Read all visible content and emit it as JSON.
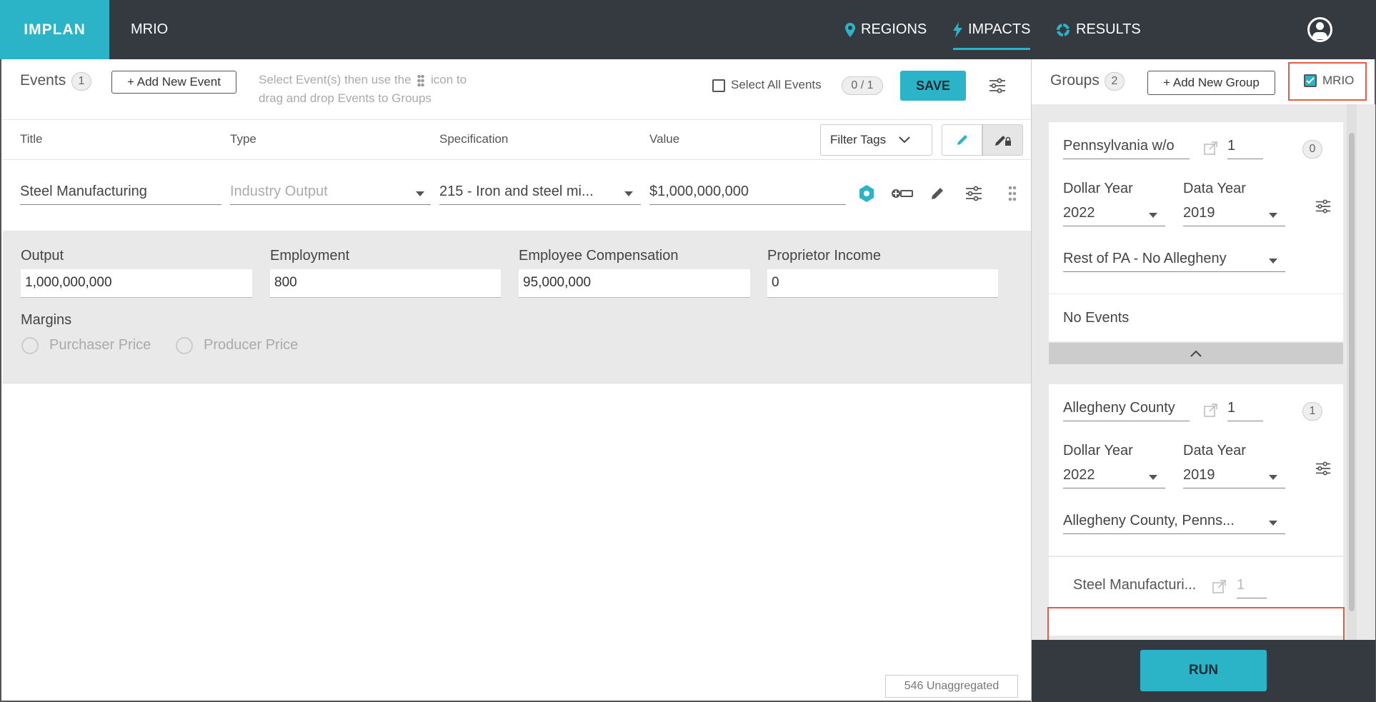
{
  "topbar": {
    "brand": "IMPLAN",
    "app_title": "MRIO",
    "nav": [
      {
        "label": "REGIONS",
        "icon": "map-pin-icon"
      },
      {
        "label": "IMPACTS",
        "icon": "lightning-icon",
        "active": true
      },
      {
        "label": "RESULTS",
        "icon": "results-icon"
      }
    ]
  },
  "events": {
    "heading": "Events",
    "count": "1",
    "add_button": "+ Add New Event",
    "hint_line1_a": "Select Event(s) then use the",
    "hint_line1_b": "icon to",
    "hint_line2": "drag and drop Events to Groups",
    "select_all_label": "Select All Events",
    "selection_counter": "0 / 1",
    "save_label": "SAVE",
    "columns": {
      "title": "Title",
      "type": "Type",
      "specification": "Specification",
      "value": "Value"
    },
    "filter_tags": "Filter Tags",
    "row": {
      "title": "Steel Manufacturing",
      "type": "Industry Output",
      "specification": "215 - Iron and steel mi...",
      "value": "$1,000,000,000"
    },
    "detail": {
      "output_label": "Output",
      "output_value": "1,000,000,000",
      "employment_label": "Employment",
      "employment_value": "800",
      "comp_label": "Employee Compensation",
      "comp_value": "95,000,000",
      "proprietor_label": "Proprietor Income",
      "proprietor_value": "0",
      "margins_label": "Margins",
      "purchaser_price": "Purchaser Price",
      "producer_price": "Producer Price"
    },
    "unaggregated": "546 Unaggregated"
  },
  "groups": {
    "heading": "Groups",
    "count": "2",
    "add_button": "+ Add New Group",
    "mrio_label": "MRIO",
    "mrio_checked": true,
    "dollar_year_label": "Dollar Year",
    "data_year_label": "Data Year",
    "items": [
      {
        "name": "Pennsylvania w/o",
        "multiplier": "1",
        "event_count": "0",
        "dollar_year": "2022",
        "data_year": "2019",
        "region": "Rest of PA - No Allegheny",
        "no_events": "No Events"
      },
      {
        "name": "Allegheny County",
        "multiplier": "1",
        "event_count": "1",
        "dollar_year": "2022",
        "data_year": "2019",
        "region": "Allegheny County, Penns...",
        "event_name": "Steel Manufacturi...",
        "event_multiplier": "1"
      }
    ],
    "run_label": "RUN"
  },
  "colors": {
    "accent": "#2bb4c8",
    "topbar": "#343a40",
    "highlight": "#e45b46"
  }
}
